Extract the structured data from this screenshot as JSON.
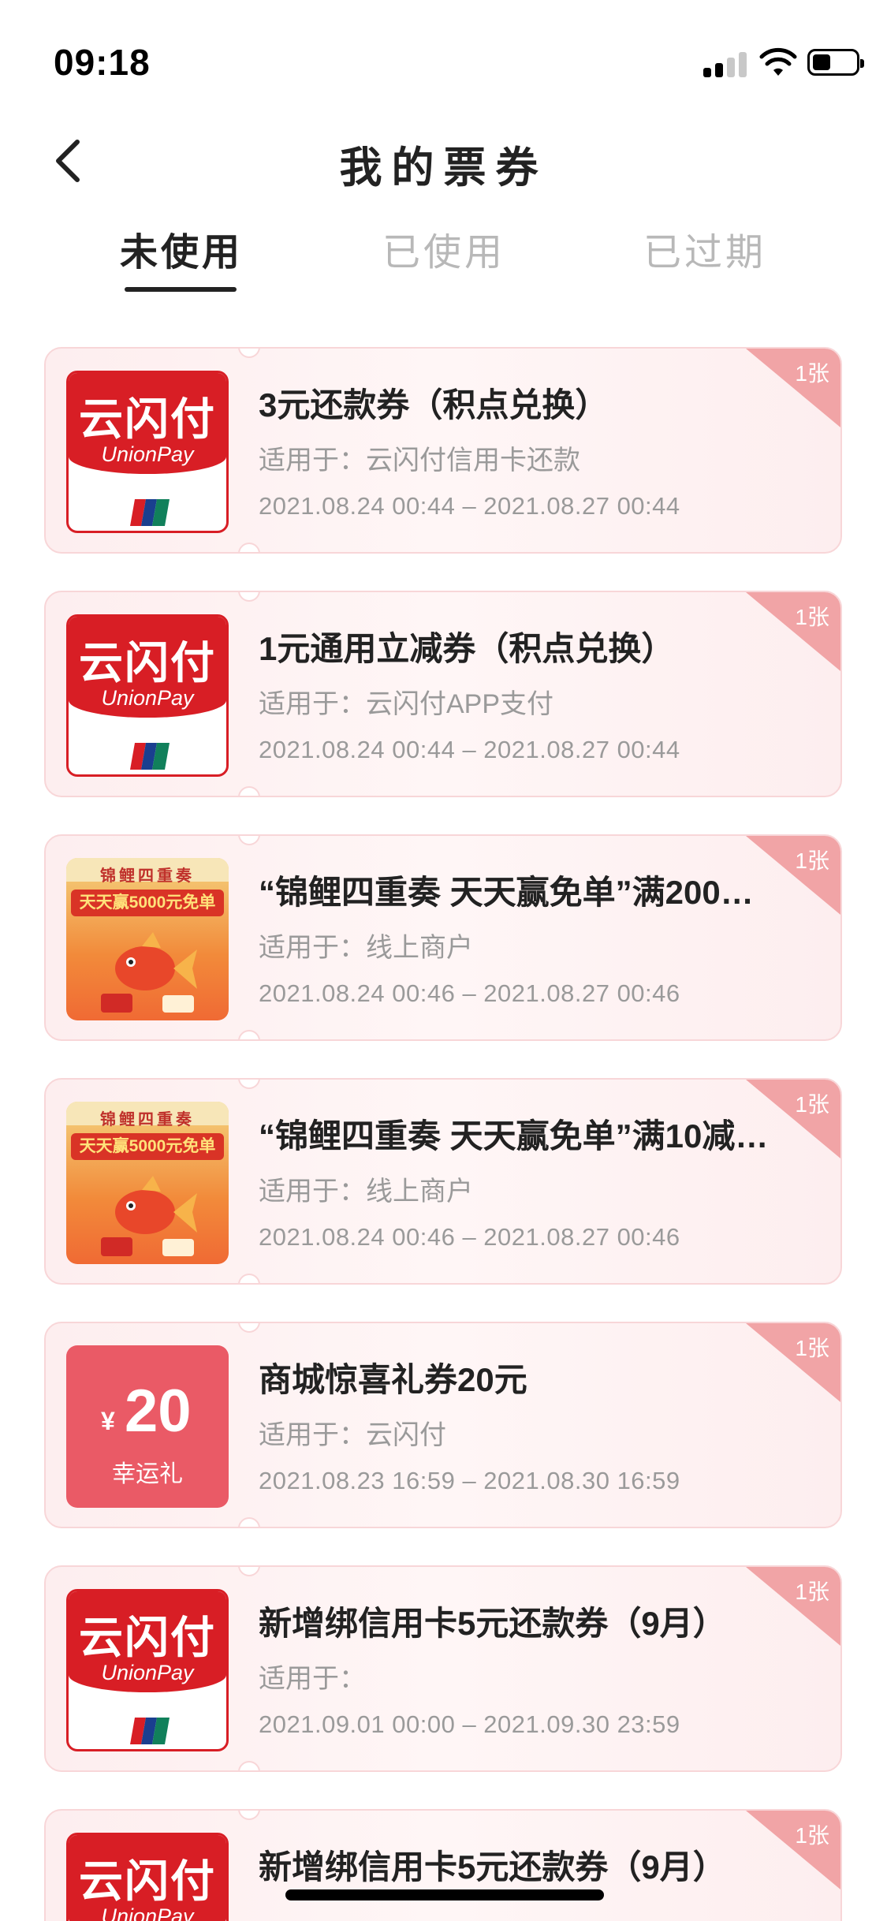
{
  "status_bar": {
    "time": "09:18"
  },
  "header": {
    "title": "我的票券"
  },
  "tabs": [
    {
      "label": "未使用",
      "active": true
    },
    {
      "label": "已使用",
      "active": false
    },
    {
      "label": "已过期",
      "active": false
    }
  ],
  "coupons": [
    {
      "thumb": "unionpay-logo",
      "title": "3元还款券（积点兑换）",
      "scope": "适用于：云闪付信用卡还款",
      "date": "2021.08.24 00:44 – 2021.08.27 00:44",
      "badge": "1张"
    },
    {
      "thumb": "unionpay-logo",
      "title": "1元通用立减券（积点兑换）",
      "scope": "适用于：云闪付APP支付",
      "date": "2021.08.24 00:44 – 2021.08.27 00:44",
      "badge": "1张"
    },
    {
      "thumb": "koi-banner",
      "title": "“锦鲤四重奏 天天赢免单”满200…",
      "scope": "适用于：线上商户",
      "date": "2021.08.24 00:46 – 2021.08.27 00:46",
      "badge": "1张"
    },
    {
      "thumb": "koi-banner",
      "title": "“锦鲤四重奏 天天赢免单”满10减…",
      "scope": "适用于：线上商户",
      "date": "2021.08.24 00:46 – 2021.08.27 00:46",
      "badge": "1张"
    },
    {
      "thumb": "amount-tile",
      "title": "商城惊喜礼券20元",
      "scope": "适用于：云闪付",
      "date": "2021.08.23 16:59 – 2021.08.30 16:59",
      "badge": "1张"
    },
    {
      "thumb": "unionpay-logo",
      "title": "新增绑信用卡5元还款券（9月）",
      "scope": "适用于：",
      "date": "2021.09.01 00:00 – 2021.09.30 23:59",
      "badge": "1张"
    },
    {
      "thumb": "unionpay-logo",
      "title": "新增绑信用卡5元还款券（9月）",
      "scope": "",
      "date": "",
      "badge": "1张"
    }
  ],
  "thumbs": {
    "unionpay": {
      "cn": "云闪付",
      "en": "UnionPay"
    },
    "koi": {
      "line1": "锦鲤四重奏",
      "line2": "天天赢5000元免单"
    },
    "amount": {
      "currency": "¥",
      "value": "20",
      "label": "幸运礼"
    }
  },
  "colors": {
    "accent_red": "#d81e25",
    "corner_badge": "#f1a4a6",
    "amount_tile": "#ea5a66",
    "card_border": "#f8d6d8"
  }
}
